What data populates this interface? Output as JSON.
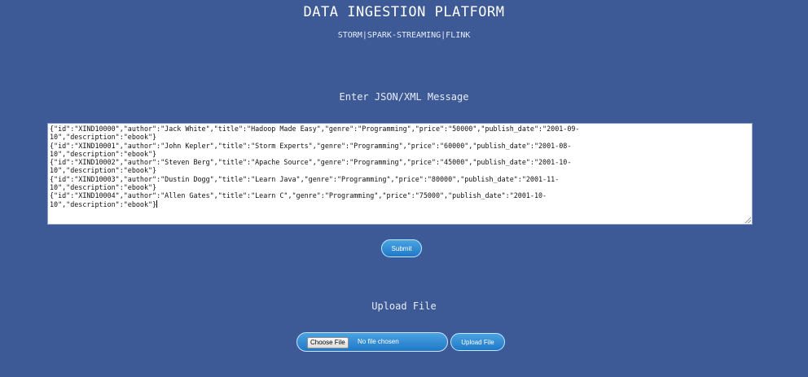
{
  "header": {
    "title": "DATA INGESTION PLATFORM",
    "subtitle": "STORM|SPARK-STREAMING|FLINK"
  },
  "json_section": {
    "label": "Enter JSON/XML Message",
    "message_lines": [
      "{\"id\":\"XIND10000\",\"author\":\"Jack White\",\"title\":\"Hadoop Made Easy\",\"genre\":\"Programming\",\"price\":\"50000\",\"publish_date\":\"2001-09-",
      "10\",\"description\":\"ebook\"}",
      "{\"id\":\"XIND10001\",\"author\":\"John Kepler\",\"title\":\"Storm Experts\",\"genre\":\"Programming\",\"price\":\"60000\",\"publish_date\":\"2001-08-",
      "10\",\"description\":\"ebook\"}",
      "{\"id\":\"XIND10002\",\"author\":\"Steven Berg\",\"title\":\"Apache Source\",\"genre\":\"Programming\",\"price\":\"45000\",\"publish_date\":\"2001-10-",
      "10\",\"description\":\"ebook\"}",
      "{\"id\":\"XIND10003\",\"author\":\"Dustin Dogg\",\"title\":\"Learn Java\",\"genre\":\"Programming\",\"price\":\"80000\",\"publish_date\":\"2001-11-",
      "10\",\"description\":\"ebook\"}",
      "{\"id\":\"XIND10004\",\"author\":\"Allen Gates\",\"title\":\"Learn C\",\"genre\":\"Programming\",\"price\":\"75000\",\"publish_date\":\"2001-10-",
      "10\",\"description\":\"ebook\"}"
    ],
    "submit_label": "Submit"
  },
  "upload_section": {
    "label": "Upload File",
    "choose_file_label": "Choose File",
    "file_status": "No file chosen",
    "upload_button_label": "Upload File"
  },
  "colors": {
    "background": "#3d5a96",
    "button": "#2a8ad6"
  }
}
